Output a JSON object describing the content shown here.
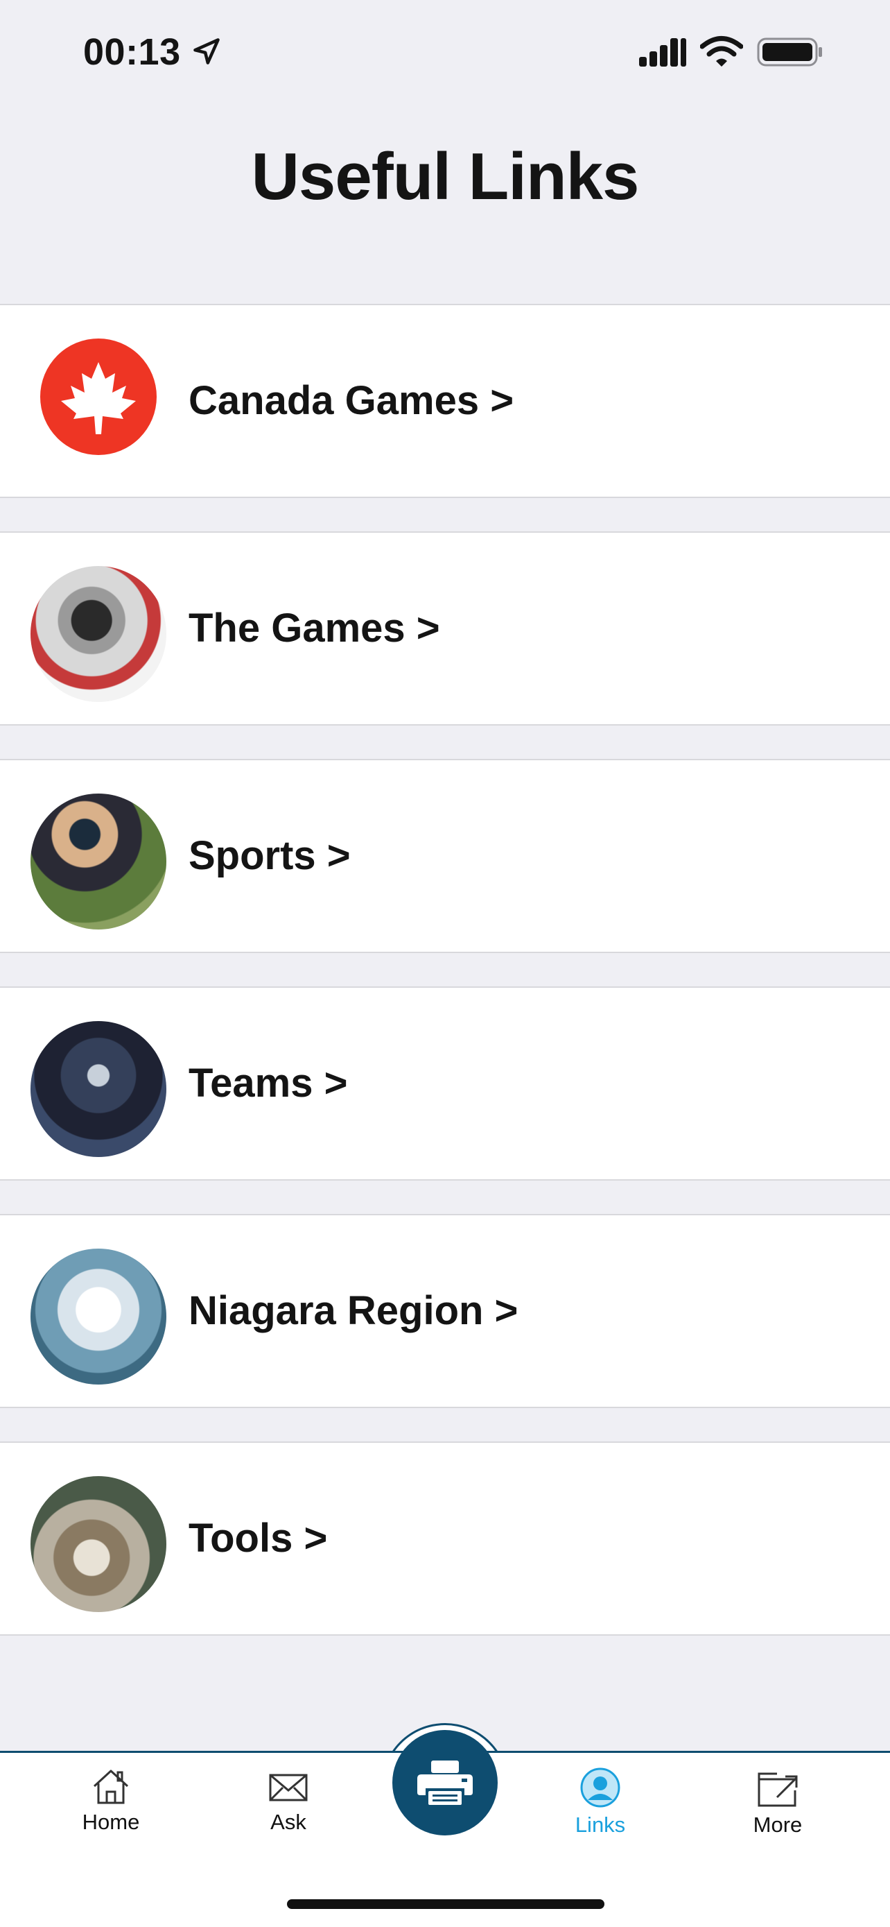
{
  "status_bar": {
    "time": "00:13",
    "icons": [
      "location-arrow-icon",
      "cellular-signal-icon",
      "wifi-icon",
      "battery-icon"
    ]
  },
  "page": {
    "title": "Useful Links"
  },
  "links": [
    {
      "label": "Canada Games >",
      "thumbnail": "canada-games-logo"
    },
    {
      "label": "The Games >",
      "thumbnail": "hockey-player-photo"
    },
    {
      "label": "Sports >",
      "thumbnail": "cyclists-photo"
    },
    {
      "label": "Teams >",
      "thumbnail": "team-crowd-photo"
    },
    {
      "label": "Niagara Region >",
      "thumbnail": "niagara-falls-photo"
    },
    {
      "label": "Tools >",
      "thumbnail": "kitten-photo"
    }
  ],
  "tab_bar": {
    "tabs": [
      {
        "label": "Home",
        "icon": "home-icon"
      },
      {
        "label": "Ask",
        "icon": "envelope-icon"
      },
      {
        "label": "Links",
        "icon": "user-circle-icon",
        "active": true
      },
      {
        "label": "More",
        "icon": "external-link-icon"
      }
    ],
    "center_action": {
      "icon": "printer-icon"
    }
  },
  "colors": {
    "background": "#efeff4",
    "accent": "#1aa0dd",
    "brand_dark": "#0e4d70",
    "canada_red": "#ee3524"
  }
}
